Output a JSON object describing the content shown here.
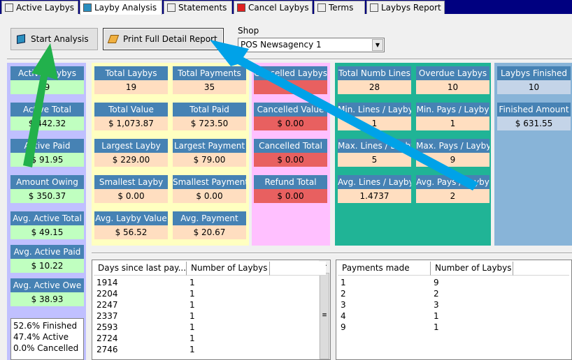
{
  "tabs": [
    {
      "label": "Active Laybys",
      "icon": "copy-icon"
    },
    {
      "label": "Layby Analysis",
      "icon": "book-icon"
    },
    {
      "label": "Statements",
      "icon": "notepad-icon"
    },
    {
      "label": "Cancel Laybys",
      "icon": "red-x-icon"
    },
    {
      "label": "Terms",
      "icon": "list-icon"
    },
    {
      "label": "Laybys Report",
      "icon": "document-icon"
    }
  ],
  "toolbar": {
    "start_label": "Start Analysis",
    "print_label": "Print Full Detail Report",
    "shop_label": "Shop",
    "shop_value": "POS Newsagency 1"
  },
  "active": [
    {
      "h": "Active Laybys",
      "v": "9"
    },
    {
      "h": "Active Total",
      "v": "$ 442.32"
    },
    {
      "h": "Active Paid",
      "v": "$ 91.95"
    },
    {
      "h": "Amount Owing",
      "v": "$ 350.37"
    },
    {
      "h": "Avg. Active Total",
      "v": "$ 49.15"
    },
    {
      "h": "Avg. Active Paid",
      "v": "$ 10.22"
    },
    {
      "h": "Avg. Active Owe",
      "v": "$ 38.93"
    }
  ],
  "percent": [
    "52.6% Finished",
    "47.4% Active",
    "0.0% Cancelled"
  ],
  "totals": [
    {
      "h": "Total Laybys",
      "v": "19"
    },
    {
      "h": "Total Payments",
      "v": "35"
    },
    {
      "h": "Total Value",
      "v": "$ 1,073.87"
    },
    {
      "h": "Total Paid",
      "v": "$ 723.50"
    },
    {
      "h": "Largest Layby",
      "v": "$ 229.00"
    },
    {
      "h": "Largest Payment",
      "v": "$ 79.00"
    },
    {
      "h": "Smallest Layby",
      "v": "$ 0.00"
    },
    {
      "h": "Smallest Payment",
      "v": "$ 0.00"
    },
    {
      "h": "Avg.  Layby Value",
      "v": "$ 56.52"
    },
    {
      "h": "Avg. Payment",
      "v": "$ 20.67"
    }
  ],
  "cancelled": [
    {
      "h": "Cancelled Laybys",
      "v": "0"
    },
    {
      "h": "Cancelled Value",
      "v": "$ 0.00"
    },
    {
      "h": "Cancelled Total",
      "v": "$ 0.00"
    },
    {
      "h": "Refund Total",
      "v": "$ 0.00"
    }
  ],
  "lines": [
    {
      "h": "Total Numb Lines",
      "v": "28"
    },
    {
      "h": "Overdue Laybys",
      "v": "10"
    },
    {
      "h": "Min. Lines / Layby",
      "v": "1"
    },
    {
      "h": "Min. Pays / Layby",
      "v": "1"
    },
    {
      "h": "Max. Lines / Layby",
      "v": "5"
    },
    {
      "h": "Max. Pays / Layby",
      "v": "9"
    },
    {
      "h": "Avg. Lines / Layby",
      "v": "1.4737"
    },
    {
      "h": "Avg. Pays / Layby",
      "v": "2"
    }
  ],
  "finished": [
    {
      "h": "Laybys Finished",
      "v": "10"
    },
    {
      "h": "Finished Amount",
      "v": "$ 631.55"
    }
  ],
  "days_list": {
    "columns": [
      "Days since last pay...",
      "Number of Laybys"
    ],
    "rows": [
      [
        "1914",
        "1"
      ],
      [
        "2204",
        "1"
      ],
      [
        "2247",
        "1"
      ],
      [
        "2337",
        "1"
      ],
      [
        "2593",
        "1"
      ],
      [
        "2724",
        "1"
      ],
      [
        "2746",
        "1"
      ]
    ]
  },
  "payments_list": {
    "columns": [
      "Payments made",
      "Number of Laybys"
    ],
    "rows": [
      [
        "1",
        "9"
      ],
      [
        "2",
        "2"
      ],
      [
        "3",
        "3"
      ],
      [
        "4",
        "1"
      ],
      [
        "9",
        "1"
      ]
    ]
  },
  "colors": {
    "green_arrow": "#22b14c",
    "blue_arrow": "#00a2e8",
    "header": "#4682b4"
  }
}
